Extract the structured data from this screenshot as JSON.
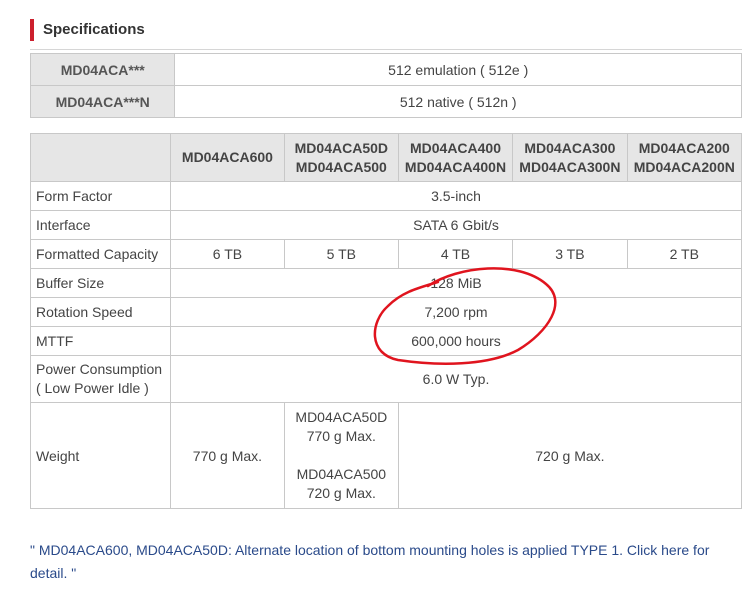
{
  "section_title": "Specifications",
  "sector_modes": [
    {
      "model": "MD04ACA***",
      "value": "512 emulation ( 512e )"
    },
    {
      "model": "MD04ACA***N",
      "value": "512 native ( 512n )"
    }
  ],
  "columns": [
    [
      "MD04ACA600"
    ],
    [
      "MD04ACA50D",
      "MD04ACA500"
    ],
    [
      "MD04ACA400",
      "MD04ACA400N"
    ],
    [
      "MD04ACA300",
      "MD04ACA300N"
    ],
    [
      "MD04ACA200",
      "MD04ACA200N"
    ]
  ],
  "rows": {
    "form_factor": {
      "label": "Form Factor",
      "value": "3.5-inch"
    },
    "interface": {
      "label": "Interface",
      "value": "SATA 6 Gbit/s"
    },
    "capacity": {
      "label": "Formatted Capacity",
      "values": [
        "6 TB",
        "5 TB",
        "4 TB",
        "3 TB",
        "2 TB"
      ]
    },
    "buffer": {
      "label": "Buffer Size",
      "value": "128 MiB"
    },
    "rotation": {
      "label": "Rotation Speed",
      "value": "7,200 rpm"
    },
    "mttf": {
      "label": "MTTF",
      "value": "600,000 hours"
    },
    "power": {
      "label_line1": "Power Consumption",
      "label_line2": "( Low Power Idle )",
      "value": "6.0 W Typ."
    },
    "weight": {
      "label": "Weight",
      "col1": "770 g Max.",
      "col2_line1": "MD04ACA50D",
      "col2_line2": "770 g Max.",
      "col2_line3": "MD04ACA500",
      "col2_line4": "720 g Max.",
      "rest": "720 g Max."
    }
  },
  "footnote": "\" MD04ACA600, MD04ACA50D: Alternate location of bottom mounting holes is applied TYPE 1. Click here for detail. \"",
  "colors": {
    "accent": "#cc1f2d",
    "header_bg": "#e6e6e6",
    "annotation": "#e0141e",
    "link": "#2a4a8a"
  }
}
